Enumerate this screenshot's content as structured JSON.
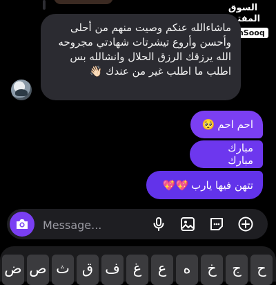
{
  "watermark": {
    "arabic": "السوق المفتوح",
    "english": "OpenSooq"
  },
  "incoming": {
    "text": "ماشاءالله عنكم وصيت منهم من أحلى وأحسن وأروع تيشرتات شهادتي مجروحه الله يرزقك الرزق الحلال وانشالله بس اطلب ما اطلب غير من عندك 👋🏻"
  },
  "outgoing": [
    {
      "text": "احم احم",
      "emoji": "🥺"
    },
    {
      "text": "مبارك مبارك",
      "emoji": ""
    },
    {
      "text": "تتهن فيها يارب",
      "emoji": "💖💖"
    }
  ],
  "composer": {
    "placeholder": "Message..."
  },
  "keyboard": {
    "keys": [
      "ح",
      "ج",
      "خ",
      "ه",
      "ع",
      "غ",
      "ف",
      "ق",
      "ث",
      "ص",
      "ض"
    ]
  },
  "colors": {
    "accent": "#7b3ff2",
    "incoming_bubble": "#2b2b31"
  },
  "icons": [
    "camera-icon",
    "microphone-icon",
    "image-icon",
    "sticker-icon",
    "plus-icon"
  ]
}
